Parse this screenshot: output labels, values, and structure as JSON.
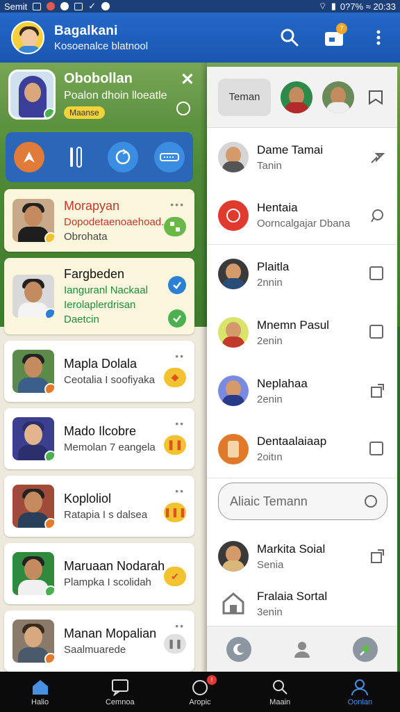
{
  "status_bar": {
    "carrier": "Semit",
    "battery_time": "0?7% ≈ 20:33"
  },
  "app_bar": {
    "title": "Bagalkani",
    "subtitle": "Kosoenalce blatnool",
    "notification_count": "7"
  },
  "profile": {
    "name": "Obobollan",
    "status": "Poalon dhoin lloeatle",
    "chip": "Maanse"
  },
  "chats": [
    {
      "name": "Morapyan",
      "message": "Dopodetaenoaehoad.",
      "message2": "Obrohata",
      "color": "#6bb84a"
    },
    {
      "name": "Fargbeden",
      "message": "Ianguranl Nackaal",
      "message2": "Ierolaplerdrisan",
      "message3": "Daetcin",
      "color": "#4caf50"
    },
    {
      "name": "Mapla Dolala",
      "message": "Ceotalia I soofiyaka",
      "color": "#f2c230"
    },
    {
      "name": "Mado Ilcobre",
      "message": "Memolan 7 eangela",
      "color": "#f2c230"
    },
    {
      "name": "Koploliol",
      "message": "Ratapia I s dalsea",
      "color": "#f2c230"
    },
    {
      "name": "Maruaan Nodarah",
      "message": "Plampka I scolidah",
      "color": "#f2c230"
    },
    {
      "name": "Manan Mopalian",
      "message": "Saalmuarede",
      "color": "#cfcfcf"
    }
  ],
  "right_panel": {
    "tab_label": "Teman",
    "contacts": [
      {
        "name": "Dame Tamai",
        "sub": "Tanin"
      },
      {
        "name": "Hentaia",
        "sub": "Oorncalgajar Dbana"
      },
      {
        "name": "Plaitla",
        "sub": "2nnin"
      },
      {
        "name": "Mnemn Pasul",
        "sub": "2enin"
      },
      {
        "name": "Neplahaa",
        "sub": "2enin"
      },
      {
        "name": "Dentaalaiaap",
        "sub": "2oitın"
      }
    ],
    "search_placeholder": "Aliaic Temann",
    "more_contacts": [
      {
        "name": "Markita Soial",
        "sub": "Senia"
      },
      {
        "name": "Fralaia Sortal",
        "sub": "3enin"
      }
    ]
  },
  "bottom_nav": [
    {
      "label": "Halio",
      "icon": "home-icon"
    },
    {
      "label": "Cemnoa",
      "icon": "chat-icon"
    },
    {
      "label": "Aropic",
      "icon": "circle-icon",
      "badge": "!"
    },
    {
      "label": "Maain",
      "icon": "search-icon"
    },
    {
      "label": "Oonlan",
      "icon": "profile-icon"
    }
  ],
  "colors": {
    "primary": "#2468c8",
    "accent_yellow": "#f3d23a",
    "nav_active": "#4a90e2"
  }
}
